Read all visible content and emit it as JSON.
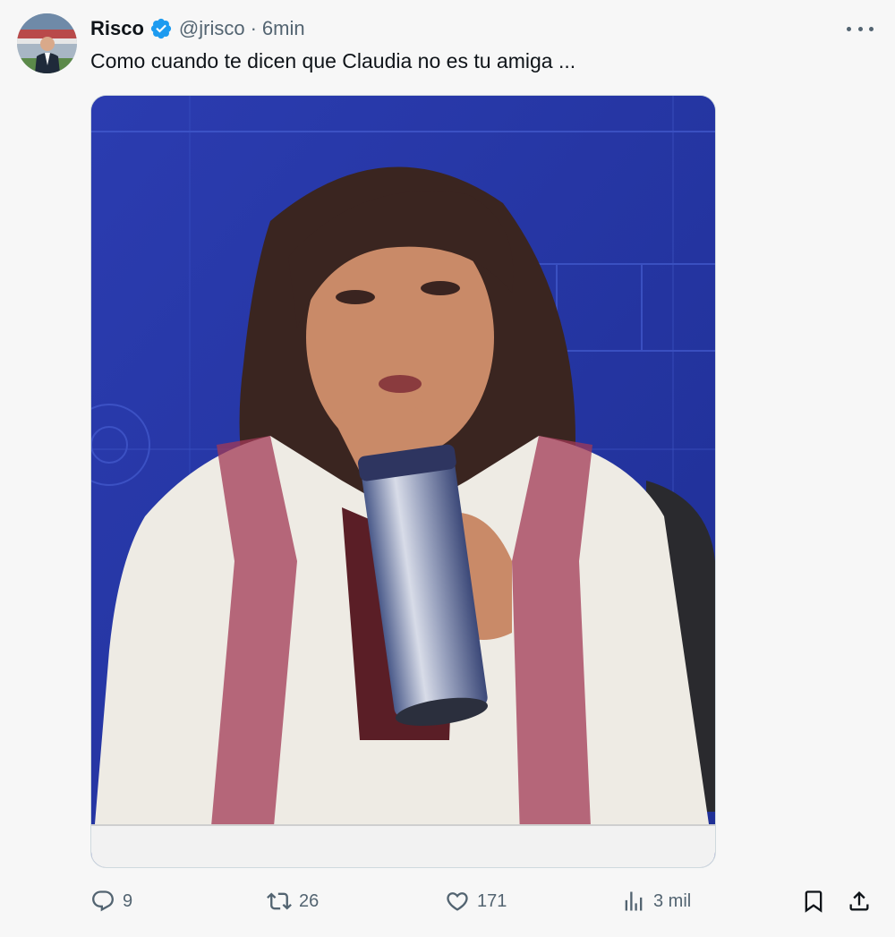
{
  "tweet": {
    "author_name": "Risco",
    "handle": "@jrisco",
    "separator": "·",
    "time": "6min",
    "text": "Como cuando te dicen que Claudia no es tu amiga ...",
    "verified": true
  },
  "actions": {
    "reply_count": "9",
    "retweet_count": "26",
    "like_count": "171",
    "views_count": "3 mil"
  },
  "icons": {
    "verified": "verified-badge-icon",
    "more": "more-options-icon",
    "reply": "reply-icon",
    "retweet": "retweet-icon",
    "like": "heart-icon",
    "views": "views-chart-icon",
    "bookmark": "bookmark-icon",
    "share": "share-icon"
  },
  "colors": {
    "verified_blue": "#1d9bf0",
    "text_primary": "#0f1419",
    "text_secondary": "#536471",
    "background": "#f7f7f7"
  }
}
